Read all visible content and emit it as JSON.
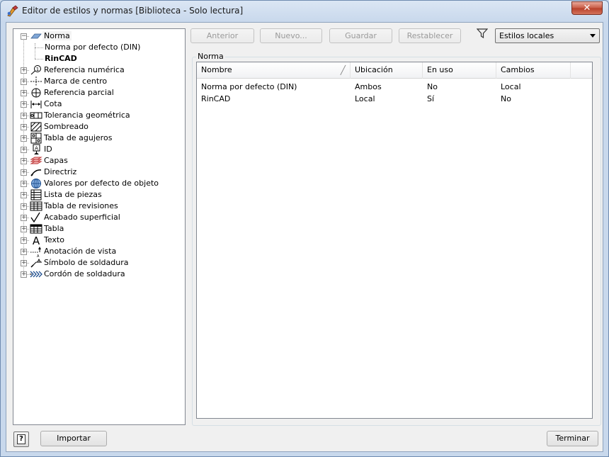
{
  "window": {
    "title": "Editor de estilos y normas [Biblioteca - Solo lectura]",
    "close_symbol": "✕"
  },
  "tree": {
    "items": [
      {
        "label": "Norma",
        "icon": "standard-icon",
        "expanded": true,
        "selected": true
      },
      {
        "label": "Norma por defecto (DIN)",
        "child": true
      },
      {
        "label": "RinCAD",
        "child": true,
        "bold": true
      },
      {
        "label": "Referencia numérica",
        "icon": "balloon-icon"
      },
      {
        "label": "Marca de centro",
        "icon": "center-mark-icon"
      },
      {
        "label": "Referencia parcial",
        "icon": "datum-target-icon"
      },
      {
        "label": "Cota",
        "icon": "dimension-icon"
      },
      {
        "label": "Tolerancia geométrica",
        "icon": "feature-control-frame-icon"
      },
      {
        "label": "Sombreado",
        "icon": "hatch-icon"
      },
      {
        "label": "Tabla de agujeros",
        "icon": "hole-table-icon"
      },
      {
        "label": "ID",
        "icon": "id-icon"
      },
      {
        "label": "Capas",
        "icon": "layers-icon"
      },
      {
        "label": "Directriz",
        "icon": "leader-icon"
      },
      {
        "label": "Valores por defecto de objeto",
        "icon": "globe-icon"
      },
      {
        "label": "Lista de piezas",
        "icon": "parts-list-icon"
      },
      {
        "label": "Tabla de revisiones",
        "icon": "revision-table-icon"
      },
      {
        "label": "Acabado superficial",
        "icon": "surface-texture-icon"
      },
      {
        "label": "Tabla",
        "icon": "table-icon"
      },
      {
        "label": "Texto",
        "icon": "text-icon"
      },
      {
        "label": "Anotación de vista",
        "icon": "view-annotation-icon"
      },
      {
        "label": "Símbolo de soldadura",
        "icon": "weld-symbol-icon"
      },
      {
        "label": "Cordón de soldadura",
        "icon": "weld-bead-icon"
      }
    ]
  },
  "toolbar": {
    "back_label": "Anterior",
    "new_label": "Nuevo...",
    "save_label": "Guardar",
    "reset_label": "Restablecer",
    "filter_icon": "filter-icon",
    "filter_value": "Estilos locales"
  },
  "main": {
    "section_label": "Norma",
    "columns": [
      "Nombre",
      "Ubicación",
      "En uso",
      "Cambios"
    ],
    "rows": [
      [
        "Norma por defecto (DIN)",
        "Ambos",
        "No",
        "Local"
      ],
      [
        "RinCAD",
        "Local",
        "Sí",
        "No"
      ]
    ]
  },
  "footer": {
    "help_label": "?",
    "import_label": "Importar",
    "finish_label": "Terminar"
  }
}
